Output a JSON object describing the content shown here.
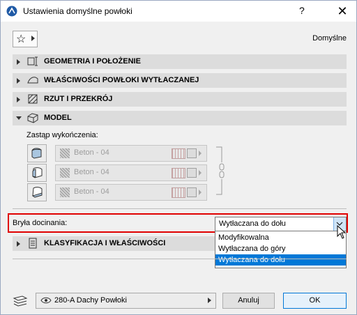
{
  "window": {
    "title": "Ustawienia domyślne powłoki",
    "help_label": "?",
    "close_label": "✕"
  },
  "toolbar": {
    "favorites_icon": "star-icon",
    "defaults_label": "Domyślne"
  },
  "sections": [
    {
      "label": "GEOMETRIA I POŁOŻENIE",
      "icon": "geometry-icon",
      "expanded": false
    },
    {
      "label": "WŁAŚCIWOŚCI POWŁOKI WYTŁACZANEJ",
      "icon": "shell-icon",
      "expanded": false
    },
    {
      "label": "RZUT I PRZEKRÓJ",
      "icon": "floor-plan-icon",
      "expanded": false
    },
    {
      "label": "MODEL",
      "icon": "model-icon",
      "expanded": true
    },
    {
      "label": "KLASYFIKACJA I WŁAŚCIWOŚCI",
      "icon": "classification-icon",
      "expanded": false
    }
  ],
  "model": {
    "override_label": "Zastąp wykończenia:",
    "surfaces": [
      {
        "name": "Beton - 04"
      },
      {
        "name": "Beton - 04"
      },
      {
        "name": "Beton - 04"
      }
    ]
  },
  "crop_body": {
    "label": "Bryła docinania:",
    "value": "Wytłaczana do dołu",
    "options": [
      "Modyfikowalna",
      "Wytłaczana do góry",
      "Wytłaczana do dołu"
    ],
    "selected_index": 2
  },
  "footer": {
    "layer": "280-A Dachy Powłoki",
    "cancel_label": "Anuluj",
    "ok_label": "OK"
  },
  "colors": {
    "highlight_border": "#e00000",
    "selection": "#0078d7",
    "section_bg": "#dcdcdc"
  }
}
